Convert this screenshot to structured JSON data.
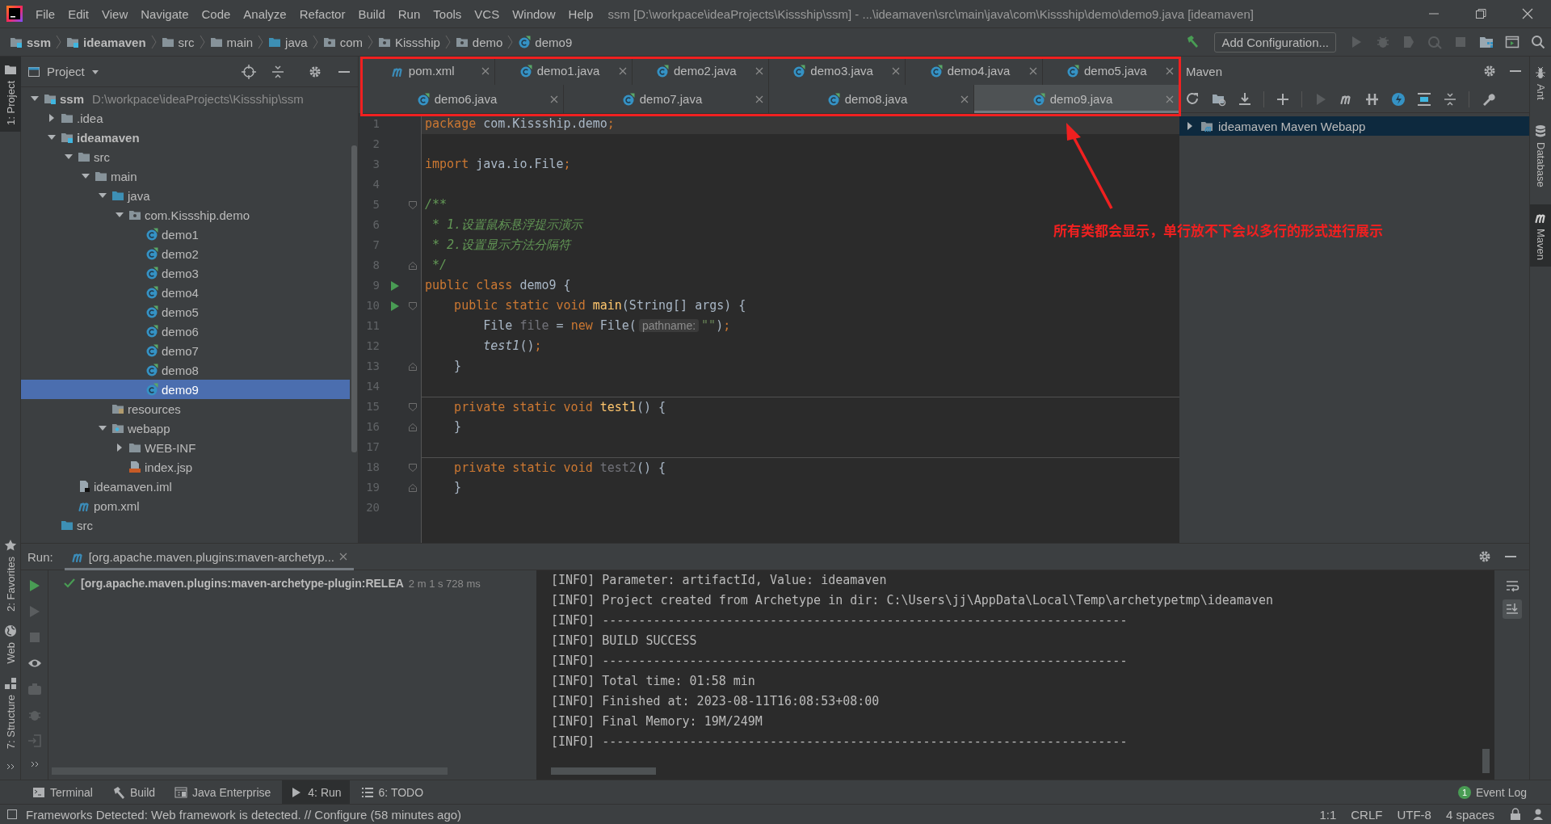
{
  "window": {
    "title": "ssm [D:\\workpace\\ideaProjects\\Kissship\\ssm] - ...\\ideamaven\\src\\main\\java\\com\\Kissship\\demo\\demo9.java [ideamaven]"
  },
  "menu": [
    "File",
    "Edit",
    "View",
    "Navigate",
    "Code",
    "Analyze",
    "Refactor",
    "Build",
    "Run",
    "Tools",
    "VCS",
    "Window",
    "Help"
  ],
  "breadcrumbs": [
    {
      "label": "ssm",
      "kind": "module"
    },
    {
      "label": "ideamaven",
      "kind": "module"
    },
    {
      "label": "src",
      "kind": "folder"
    },
    {
      "label": "main",
      "kind": "folder"
    },
    {
      "label": "java",
      "kind": "srcfolder"
    },
    {
      "label": "com",
      "kind": "package"
    },
    {
      "label": "Kissship",
      "kind": "package"
    },
    {
      "label": "demo",
      "kind": "package"
    },
    {
      "label": "demo9",
      "kind": "class"
    }
  ],
  "toolbar": {
    "run_config": "Add Configuration..."
  },
  "left_strip_top": [
    {
      "label": "1: Project",
      "kind": "folder",
      "selected": true
    }
  ],
  "left_strip_bottom": [
    {
      "label": "2: Favorites",
      "kind": "star",
      "selected": false
    },
    {
      "label": "Web",
      "kind": "globe",
      "selected": false
    },
    {
      "label": "7: Structure",
      "kind": "structure",
      "selected": false
    }
  ],
  "right_strip": [
    {
      "label": "Ant",
      "kind": "ant",
      "selected": false
    },
    {
      "label": "Database",
      "kind": "database",
      "selected": false
    },
    {
      "label": "Maven",
      "kind": "maven",
      "selected": true
    }
  ],
  "project": {
    "title": "Project",
    "tree": [
      {
        "label": "ssm",
        "kind": "module",
        "path": "D:\\workpace\\ideaProjects\\Kissship\\ssm",
        "expanded": true,
        "selected": false,
        "children": [
          {
            "label": ".idea",
            "kind": "folder",
            "expanded": false,
            "selected": false
          },
          {
            "label": "ideamaven",
            "kind": "module",
            "expanded": true,
            "selected": false,
            "children": [
              {
                "label": "src",
                "kind": "folder",
                "expanded": true,
                "selected": false,
                "children": [
                  {
                    "label": "main",
                    "kind": "folder",
                    "expanded": true,
                    "selected": false,
                    "children": [
                      {
                        "label": "java",
                        "kind": "srcfolder",
                        "expanded": true,
                        "selected": false,
                        "children": [
                          {
                            "label": "com.Kissship.demo",
                            "kind": "package",
                            "expanded": true,
                            "selected": false,
                            "children": [
                              {
                                "label": "demo1",
                                "kind": "class",
                                "selected": false
                              },
                              {
                                "label": "demo2",
                                "kind": "class",
                                "selected": false
                              },
                              {
                                "label": "demo3",
                                "kind": "class",
                                "selected": false
                              },
                              {
                                "label": "demo4",
                                "kind": "class",
                                "selected": false
                              },
                              {
                                "label": "demo5",
                                "kind": "class",
                                "selected": false
                              },
                              {
                                "label": "demo6",
                                "kind": "class",
                                "selected": false
                              },
                              {
                                "label": "demo7",
                                "kind": "class",
                                "selected": false
                              },
                              {
                                "label": "demo8",
                                "kind": "class",
                                "selected": false
                              },
                              {
                                "label": "demo9",
                                "kind": "class",
                                "selected": true
                              }
                            ]
                          }
                        ]
                      },
                      {
                        "label": "resources",
                        "kind": "resources",
                        "selected": false
                      },
                      {
                        "label": "webapp",
                        "kind": "webfolder",
                        "expanded": true,
                        "selected": false,
                        "children": [
                          {
                            "label": "WEB-INF",
                            "kind": "folder",
                            "expanded": false,
                            "selected": false
                          },
                          {
                            "label": "index.jsp",
                            "kind": "jsp",
                            "selected": false
                          }
                        ]
                      }
                    ]
                  }
                ]
              },
              {
                "label": "ideamaven.iml",
                "kind": "iml",
                "selected": false
              },
              {
                "label": "pom.xml",
                "kind": "maven",
                "selected": false
              }
            ]
          },
          {
            "label": "src",
            "kind": "srcfolder",
            "selected": false
          }
        ]
      }
    ]
  },
  "editor": {
    "tab_rows": [
      [
        {
          "label": "pom.xml",
          "kind": "maven",
          "selected": false
        },
        {
          "label": "demo1.java",
          "kind": "class",
          "selected": false
        },
        {
          "label": "demo2.java",
          "kind": "class",
          "selected": false
        },
        {
          "label": "demo3.java",
          "kind": "class",
          "selected": false
        },
        {
          "label": "demo4.java",
          "kind": "class",
          "selected": false
        },
        {
          "label": "demo5.java",
          "kind": "class",
          "selected": false
        }
      ],
      [
        {
          "label": "demo6.java",
          "kind": "class",
          "selected": false
        },
        {
          "label": "demo7.java",
          "kind": "class",
          "selected": false
        },
        {
          "label": "demo8.java",
          "kind": "class",
          "selected": false
        },
        {
          "label": "demo9.java",
          "kind": "class",
          "selected": true
        }
      ]
    ],
    "lines": [
      {
        "number": "1",
        "current": true,
        "run": false,
        "fold_start": false,
        "fold_end": false,
        "separator": false,
        "tokens": [
          {
            "text": "package",
            "kind": "keyword"
          },
          {
            "text": " com.Kissship.demo",
            "kind": "plain"
          },
          {
            "text": ";",
            "kind": "keyword"
          }
        ]
      },
      {
        "number": "2",
        "current": false,
        "run": false,
        "fold_start": false,
        "fold_end": false,
        "separator": false
      },
      {
        "number": "3",
        "current": false,
        "run": false,
        "fold_start": false,
        "fold_end": false,
        "separator": false,
        "tokens": [
          {
            "text": "import",
            "kind": "keyword"
          },
          {
            "text": " java.io.File",
            "kind": "plain"
          },
          {
            "text": ";",
            "kind": "keyword"
          }
        ]
      },
      {
        "number": "4",
        "current": false,
        "run": false,
        "fold_start": false,
        "fold_end": false,
        "separator": false
      },
      {
        "number": "5",
        "current": false,
        "run": false,
        "fold_start": true,
        "fold_end": false,
        "separator": false,
        "tokens": [
          {
            "text": "/**",
            "kind": "comment"
          }
        ]
      },
      {
        "number": "6",
        "current": false,
        "run": false,
        "fold_start": false,
        "fold_end": false,
        "separator": false,
        "tokens": [
          {
            "text": " * 1.设置鼠标悬浮提示演示",
            "kind": "comment"
          }
        ]
      },
      {
        "number": "7",
        "current": false,
        "run": false,
        "fold_start": false,
        "fold_end": false,
        "separator": false,
        "tokens": [
          {
            "text": " * 2.设置显示方法分隔符",
            "kind": "comment"
          }
        ]
      },
      {
        "number": "8",
        "current": false,
        "run": false,
        "fold_start": false,
        "fold_end": true,
        "separator": false,
        "tokens": [
          {
            "text": " */",
            "kind": "comment"
          }
        ]
      },
      {
        "number": "9",
        "current": false,
        "run": true,
        "fold_start": false,
        "fold_end": false,
        "separator": false,
        "tokens": [
          {
            "text": "public class",
            "kind": "keyword"
          },
          {
            "text": " demo9 {",
            "kind": "plain"
          }
        ]
      },
      {
        "number": "10",
        "current": false,
        "run": true,
        "fold_start": true,
        "fold_end": false,
        "separator": false,
        "tokens": [
          {
            "text": "    public static void ",
            "kind": "keyword"
          },
          {
            "text": "main",
            "kind": "method"
          },
          {
            "text": "(String[] args) {",
            "kind": "plain"
          }
        ]
      },
      {
        "number": "11",
        "current": false,
        "run": false,
        "fold_start": false,
        "fold_end": false,
        "separator": false,
        "tokens": [
          {
            "text": "        File ",
            "kind": "plain"
          },
          {
            "text": "file",
            "kind": "unused"
          },
          {
            "text": " = ",
            "kind": "plain"
          },
          {
            "text": "new",
            "kind": "keyword"
          },
          {
            "text": " File(",
            "kind": "plain"
          },
          {
            "text": "pathname:",
            "kind": "hint"
          },
          {
            "text": "\"\"",
            "kind": "string"
          },
          {
            "text": ")",
            "kind": "plain"
          },
          {
            "text": ";",
            "kind": "keyword"
          }
        ]
      },
      {
        "number": "12",
        "current": false,
        "run": false,
        "fold_start": false,
        "fold_end": false,
        "separator": false,
        "tokens": [
          {
            "text": "        test1",
            "kind": "static-call"
          },
          {
            "text": "()",
            "kind": "plain"
          },
          {
            "text": ";",
            "kind": "keyword"
          }
        ]
      },
      {
        "number": "13",
        "current": false,
        "run": false,
        "fold_start": false,
        "fold_end": true,
        "separator": false,
        "tokens": [
          {
            "text": "    }",
            "kind": "plain"
          }
        ]
      },
      {
        "number": "14",
        "current": false,
        "run": false,
        "fold_start": false,
        "fold_end": false,
        "separator": false
      },
      {
        "number": "15",
        "current": false,
        "run": false,
        "fold_start": true,
        "fold_end": false,
        "separator": true,
        "tokens": [
          {
            "text": "    private static void ",
            "kind": "keyword"
          },
          {
            "text": "test1",
            "kind": "method"
          },
          {
            "text": "() {",
            "kind": "plain"
          }
        ]
      },
      {
        "number": "16",
        "current": false,
        "run": false,
        "fold_start": false,
        "fold_end": true,
        "separator": false,
        "tokens": [
          {
            "text": "    }",
            "kind": "plain"
          }
        ]
      },
      {
        "number": "17",
        "current": false,
        "run": false,
        "fold_start": false,
        "fold_end": false,
        "separator": false
      },
      {
        "number": "18",
        "current": false,
        "run": false,
        "fold_start": true,
        "fold_end": false,
        "separator": true,
        "tokens": [
          {
            "text": "    private static void ",
            "kind": "keyword"
          },
          {
            "text": "test2",
            "kind": "unused"
          },
          {
            "text": "() {",
            "kind": "plain"
          }
        ]
      },
      {
        "number": "19",
        "current": false,
        "run": false,
        "fold_start": false,
        "fold_end": true,
        "separator": false,
        "tokens": [
          {
            "text": "    }",
            "kind": "plain"
          }
        ]
      },
      {
        "number": "20",
        "current": false,
        "run": false,
        "fold_start": false,
        "fold_end": false,
        "separator": false
      }
    ]
  },
  "annotation": {
    "text": "所有类都会显示，单行放不下会以多行的形式进行展示"
  },
  "maven": {
    "title": "Maven",
    "tree": [
      {
        "label": "ideamaven Maven Webapp",
        "expanded": false,
        "selected": true
      }
    ]
  },
  "run": {
    "label": "Run:",
    "tab": {
      "label": "[org.apache.maven.plugins:maven-archetyp...",
      "selected": true
    },
    "tree": [
      {
        "label": "[org.apache.maven.plugins:maven-archetype-plugin:RELEA",
        "time": "2 m 1 s 728 ms",
        "succeeded": true
      }
    ],
    "console": [
      "[INFO] Parameter: artifactId, Value: ideamaven",
      "[INFO] Project created from Archetype in dir: C:\\Users\\jj\\AppData\\Local\\Temp\\archetypetmp\\ideamaven",
      "[INFO] ------------------------------------------------------------------------",
      "[INFO] BUILD SUCCESS",
      "[INFO] ------------------------------------------------------------------------",
      "[INFO] Total time: 01:58 min",
      "[INFO] Finished at: 2023-08-11T16:08:53+08:00",
      "[INFO] Final Memory: 19M/249M",
      "[INFO] ------------------------------------------------------------------------"
    ]
  },
  "bottom_tabs": [
    {
      "label": "Terminal",
      "kind": "terminal",
      "selected": false
    },
    {
      "label": "Build",
      "kind": "build",
      "selected": false
    },
    {
      "label": "Java Enterprise",
      "kind": "enterprise",
      "selected": false
    },
    {
      "label": "4: Run",
      "kind": "run",
      "selected": true
    },
    {
      "label": "6: TODO",
      "kind": "todo",
      "selected": false
    }
  ],
  "event_log": {
    "label": "Event Log",
    "badge": "1"
  },
  "status": {
    "message": "Frameworks Detected: Web framework is detected. // Configure (58 minutes ago)",
    "items": [
      "1:1",
      "CRLF",
      "UTF-8",
      "4 spaces"
    ]
  }
}
